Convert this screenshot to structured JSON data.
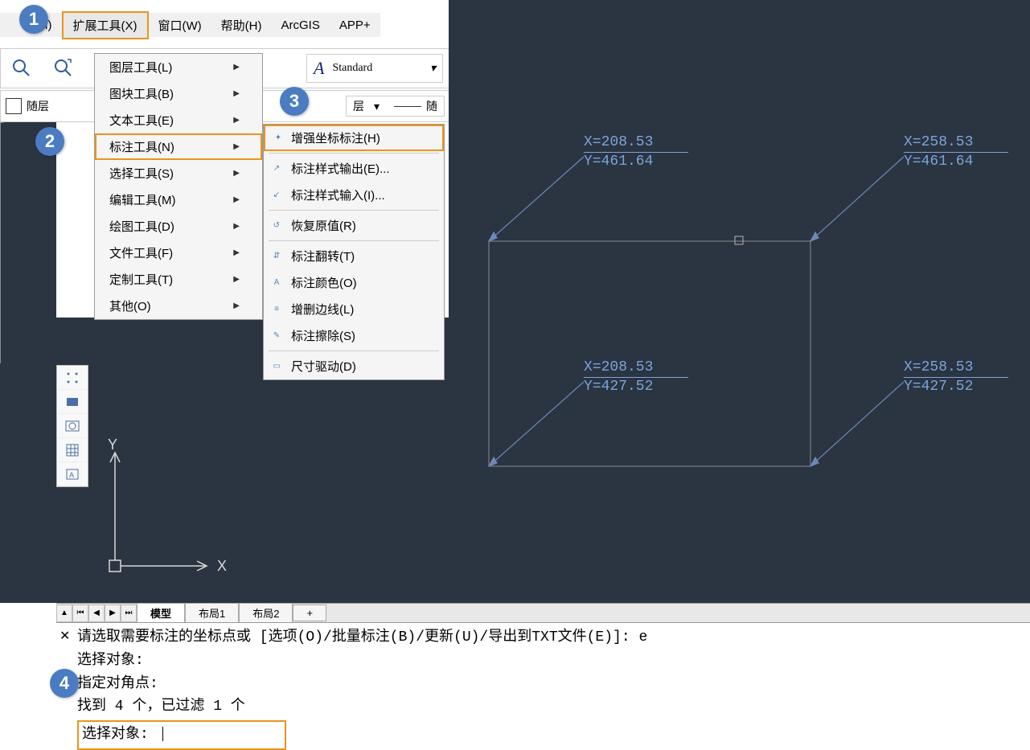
{
  "menubar": {
    "partial_m": "(M)",
    "extend_tools": "扩展工具(X)",
    "window": "窗口(W)",
    "help": "帮助(H)",
    "arcgis": "ArcGIS",
    "app_plus": "APP+"
  },
  "toolbar": {
    "text_style": "Standard",
    "layer_prefix": "随层",
    "layer_char": "层",
    "layer_suffix": "随"
  },
  "dropdown1": {
    "layer_tools": "图层工具(L)",
    "block_tools": "图块工具(B)",
    "text_tools": "文本工具(E)",
    "dim_tools": "标注工具(N)",
    "select_tools": "选择工具(S)",
    "edit_tools": "编辑工具(M)",
    "draw_tools": "绘图工具(D)",
    "file_tools": "文件工具(F)",
    "custom_tools": "定制工具(T)",
    "other": "其他(O)"
  },
  "dropdown2": {
    "enhanced_coord": "增强坐标标注(H)",
    "style_export": "标注样式输出(E)...",
    "style_import": "标注样式输入(I)...",
    "restore": "恢复原值(R)",
    "flip": "标注翻转(T)",
    "color": "标注颜色(O)",
    "add_del_line": "增删边线(L)",
    "dim_erase": "标注擦除(S)",
    "size_drive": "尺寸驱动(D)"
  },
  "coords": {
    "tl": {
      "x": "X=208.53",
      "y": "Y=461.64"
    },
    "tr": {
      "x": "X=258.53",
      "y": "Y=461.64"
    },
    "bl": {
      "x": "X=208.53",
      "y": "Y=427.52"
    },
    "br": {
      "x": "X=258.53",
      "y": "Y=427.52"
    }
  },
  "ucs": {
    "x": "X",
    "y": "Y"
  },
  "tabs": {
    "model": "模型",
    "layout1": "布局1",
    "layout2": "布局2",
    "plus": "+"
  },
  "cmd": {
    "line1": "请选取需要标注的坐标点或 [选项(O)/批量标注(B)/更新(U)/导出到TXT文件(E)]: e",
    "line2": "选择对象:",
    "line3": "指定对角点:",
    "line4": "找到 4 个，已过滤 1 个",
    "prompt": "选择对象:"
  },
  "steps": {
    "s1": "1",
    "s2": "2",
    "s3": "3",
    "s4": "4"
  }
}
